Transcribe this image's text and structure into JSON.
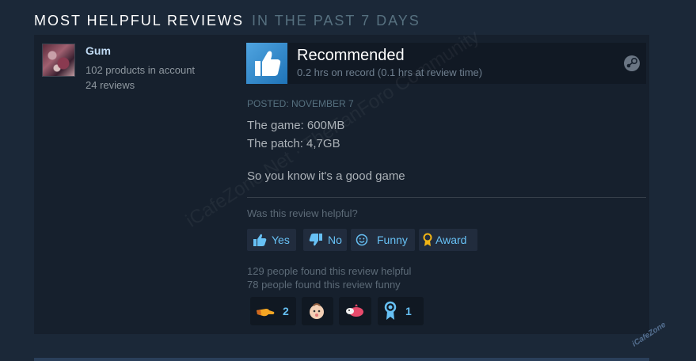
{
  "section": {
    "title": "MOST HELPFUL REVIEWS",
    "subtitle": "IN THE PAST 7 DAYS"
  },
  "author": {
    "name": "Gum",
    "products": "102 products in account",
    "reviews": "24 reviews"
  },
  "review": {
    "verdict": "Recommended",
    "hours": "0.2 hrs on record (0.1 hrs at review time)",
    "posted": "POSTED: NOVEMBER 7",
    "lines": [
      "The game: 600MB",
      "The patch: 4,7GB",
      "So you know it's a good game"
    ],
    "helpful_question": "Was this review helpful?",
    "buttons": {
      "yes": "Yes",
      "no": "No",
      "funny": "Funny",
      "award": "Award"
    },
    "helpful_count": "129 people found this review helpful",
    "funny_count": "78 people found this review funny",
    "awards": [
      {
        "icon": "hand-point-icon",
        "count": "2"
      },
      {
        "icon": "baby-face-icon",
        "count": ""
      },
      {
        "icon": "pig-icon",
        "count": ""
      },
      {
        "icon": "ribbon-award-icon",
        "count": "1"
      }
    ]
  },
  "watermark": {
    "diagonal": "iCafeZone Net · TheFanForo Community",
    "corner": "iCafeZone"
  },
  "colors": {
    "background": "#1b2838",
    "review_panel": "#16202d",
    "accent_blue": "#67c1f5",
    "thumb_up": "#3a8fd0"
  }
}
